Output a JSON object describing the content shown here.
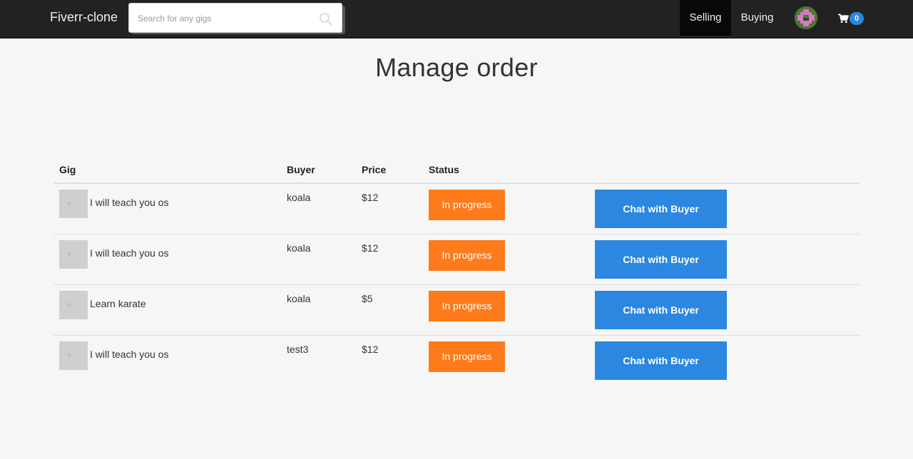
{
  "navbar": {
    "brand": "Fiverr-clone",
    "search_placeholder": "Search for any gigs",
    "selling_label": "Selling",
    "buying_label": "Buying",
    "cart_count": "0"
  },
  "page": {
    "title": "Manage order"
  },
  "table": {
    "headers": {
      "gig": "Gig",
      "buyer": "Buyer",
      "price": "Price",
      "status": "Status"
    },
    "rows": [
      {
        "gig": "I will teach you os",
        "buyer": "koala",
        "price": "$12",
        "status": "In progress",
        "action": "Chat with Buyer"
      },
      {
        "gig": "I will teach you os",
        "buyer": "koala",
        "price": "$12",
        "status": "In progress",
        "action": "Chat with Buyer"
      },
      {
        "gig": "Learn karate",
        "buyer": "koala",
        "price": "$5",
        "status": "In progress",
        "action": "Chat with Buyer"
      },
      {
        "gig": "I will teach you os",
        "buyer": "test3",
        "price": "$12",
        "status": "In progress",
        "action": "Chat with Buyer"
      }
    ]
  },
  "colors": {
    "navbar": "#222222",
    "status_badge": "#ff7a1a",
    "chat_button": "#2b87e0",
    "cart_badge": "#2b87d8"
  },
  "icons": {
    "search": "search-icon",
    "cart": "cart-icon",
    "avatar": "avatar"
  }
}
